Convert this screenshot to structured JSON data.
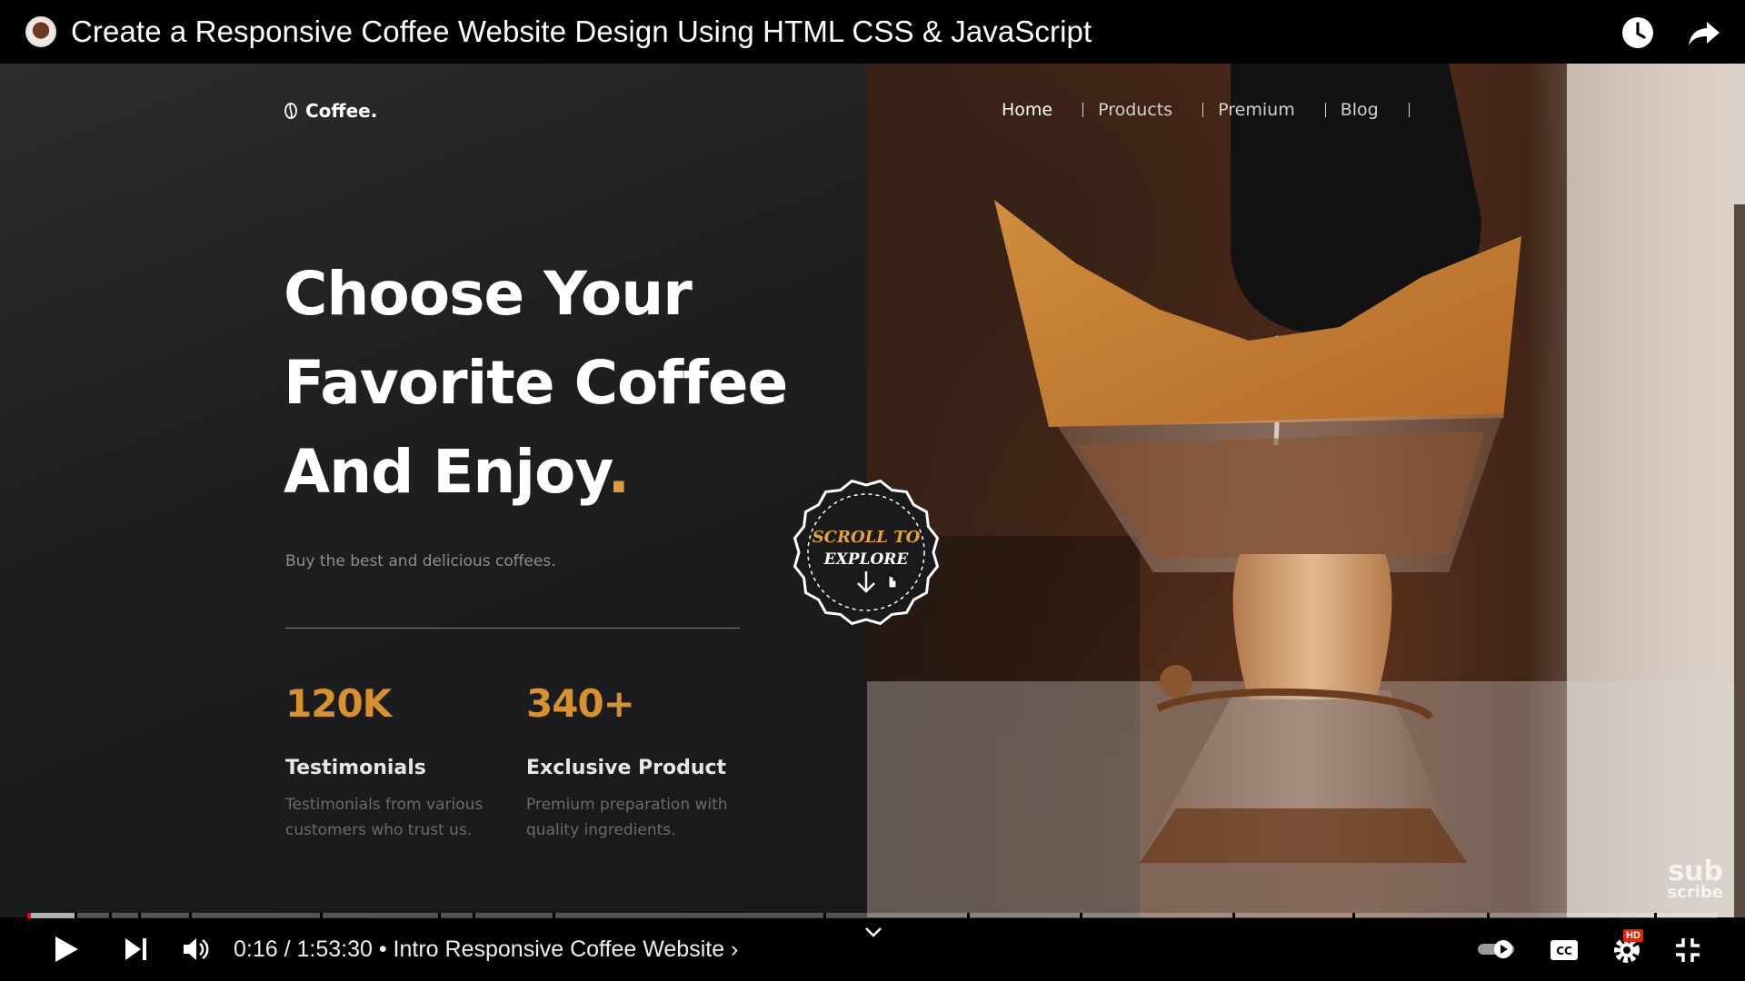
{
  "video": {
    "title": "Create a Responsive Coffee Website Design Using HTML CSS & JavaScript",
    "time_current": "0:16",
    "time_total": "1:53:30",
    "time_display": "0:16 / 1:53:30",
    "chapter": "• Intro Responsive Coffee Website ›",
    "progress_played_fraction": 0.0024
  },
  "site": {
    "logo_text": "Coffee.",
    "nav": [
      "Home",
      "Products",
      "Premium",
      "Blog"
    ],
    "hero": {
      "line1": "Choose Your",
      "line2": "Favorite Coffee",
      "line3": "And Enjoy",
      "dot": ".",
      "subtitle": "Buy the best and delicious coffees."
    },
    "stats": [
      {
        "number": "120K",
        "label": "Testimonials",
        "desc_line1": "Testimonials from various",
        "desc_line2": "customers who trust us."
      },
      {
        "number": "340+",
        "label": "Exclusive Product",
        "desc_line1": "Premium preparation with",
        "desc_line2": "quality ingredients."
      }
    ],
    "scroll_badge": {
      "line1": "SCROLL TO",
      "line2": "EXPLORE"
    }
  },
  "watermark": {
    "line1": "sub",
    "line2": "scribe"
  },
  "colors": {
    "accent": "#d7912f",
    "youtube_red": "#ff0000"
  },
  "icons": {
    "top": [
      "watch-later-icon",
      "share-icon"
    ],
    "controls": [
      "play-icon",
      "next-icon",
      "volume-icon",
      "chapter-chevron-icon",
      "autoplay-toggle-icon",
      "captions-icon",
      "settings-icon",
      "exit-fullscreen-icon"
    ]
  },
  "settings_badge": "HD"
}
